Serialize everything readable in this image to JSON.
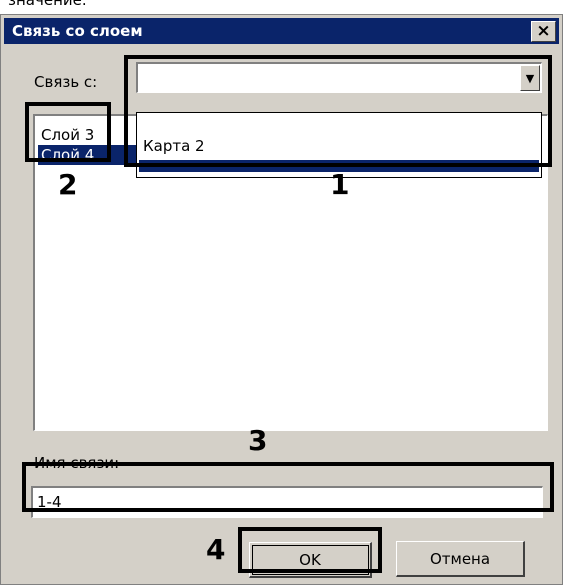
{
  "partial_top_text": "значение.",
  "dialog": {
    "title": "Связь со слоем",
    "close_label": "×"
  },
  "link_with": {
    "label": "Связь с:",
    "value": "",
    "dropdown_arrow": "▼",
    "options": [
      "Карта 2"
    ]
  },
  "layers_list": {
    "items": [
      "Слой 3",
      "Слой 4"
    ],
    "selected_index": 1
  },
  "link_name": {
    "label": "Имя связи:",
    "value": "1-4"
  },
  "buttons": {
    "ok": "OK",
    "cancel": "Отмена"
  },
  "annotations": [
    "1",
    "2",
    "3",
    "4"
  ],
  "colors": {
    "title_bar": "#0a246a",
    "dialog_bg": "#d4d0c8",
    "selection": "#0a246a",
    "annotation": "#000000"
  }
}
